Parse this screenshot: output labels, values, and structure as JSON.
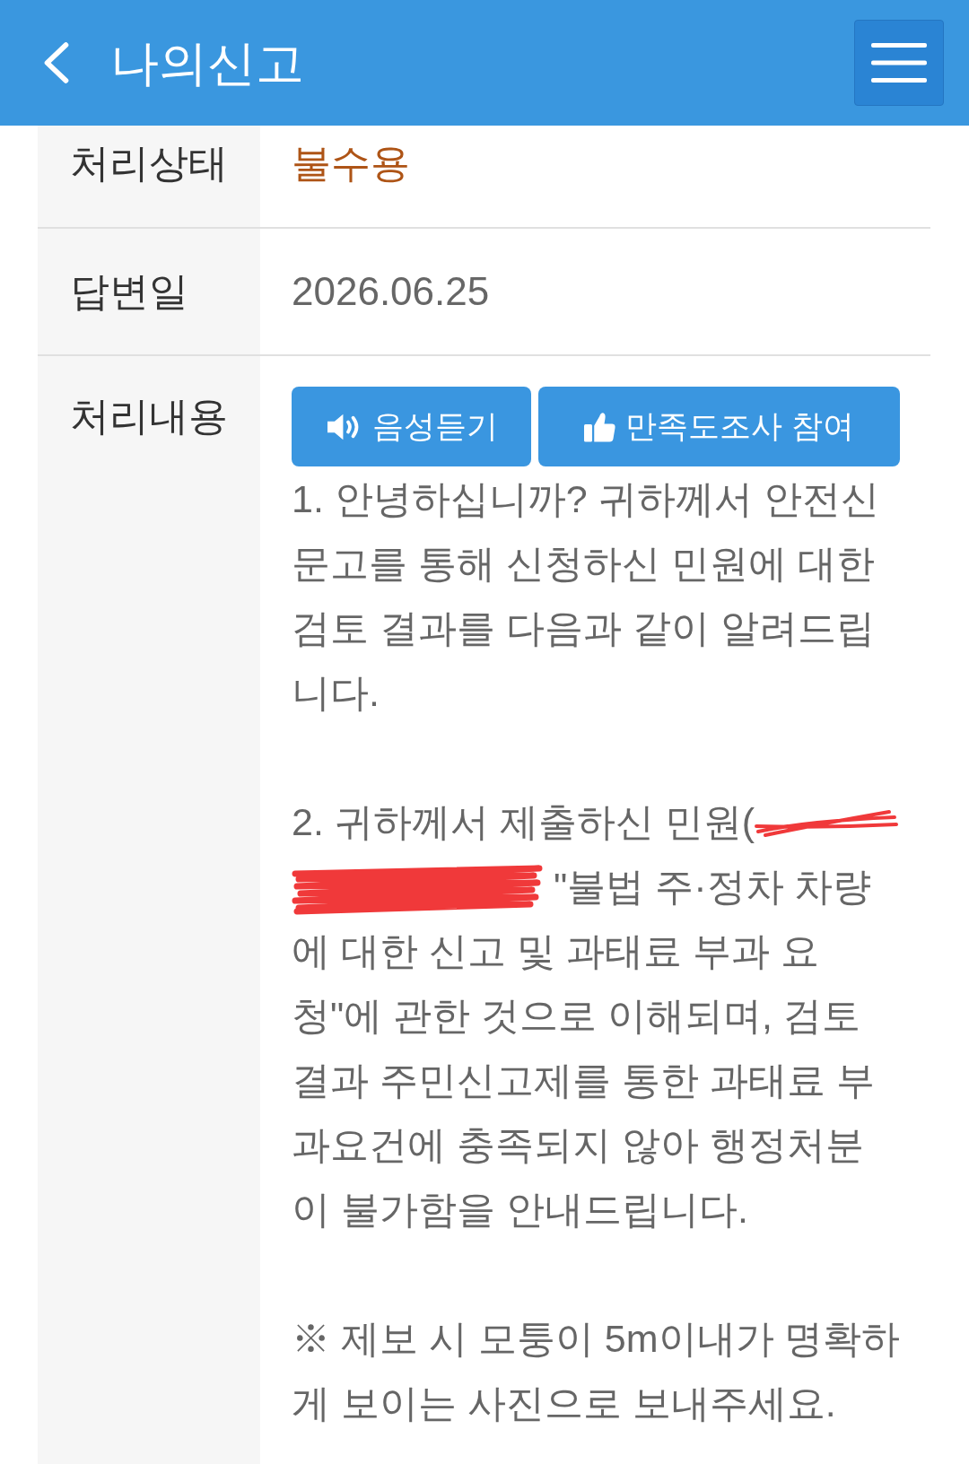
{
  "header": {
    "title": "나의신고"
  },
  "details": [
    {
      "kind": "status",
      "label": "처리상태",
      "value": "불수용"
    },
    {
      "kind": "date",
      "label": "답변일",
      "value": "2026.06.25"
    },
    {
      "kind": "content",
      "label": "처리내용",
      "buttons": [
        {
          "kind": "listen",
          "label": "음성듣기"
        },
        {
          "kind": "survey",
          "label": "만족도조사 참여"
        }
      ],
      "paragraphs": [
        {
          "parts": [
            {
              "kind": "text",
              "text": "1. 안녕하십니까? 귀하께서 안전신문고를 통해 신청하신 민원에 대한 검토 결과를 다음과 같이 알려드립니다."
            }
          ]
        },
        {
          "parts": [
            {
              "kind": "text",
              "text": "2. 귀하께서 제출하신 민원("
            },
            {
              "kind": "scribble"
            },
            {
              "kind": "scribble"
            },
            {
              "kind": "text",
              "text": "\"불법 주·정차 차량"
            },
            {
              "kind": "text",
              "text": "에 대한 신고 및 과태료 부과 요청\"에 관한 것으로 이해되며, 검토 결과 주민신고제를 통한 과태료 부과요건에 충족되지 않아 행정처분이 불가함을 안내드립니다."
            }
          ]
        },
        {
          "parts": [
            {
              "kind": "text",
              "text": "※ 제보 시 모퉁이 5m이내가 명확하게 보이는 사진으로 보내주세요."
            }
          ]
        }
      ]
    }
  ]
}
